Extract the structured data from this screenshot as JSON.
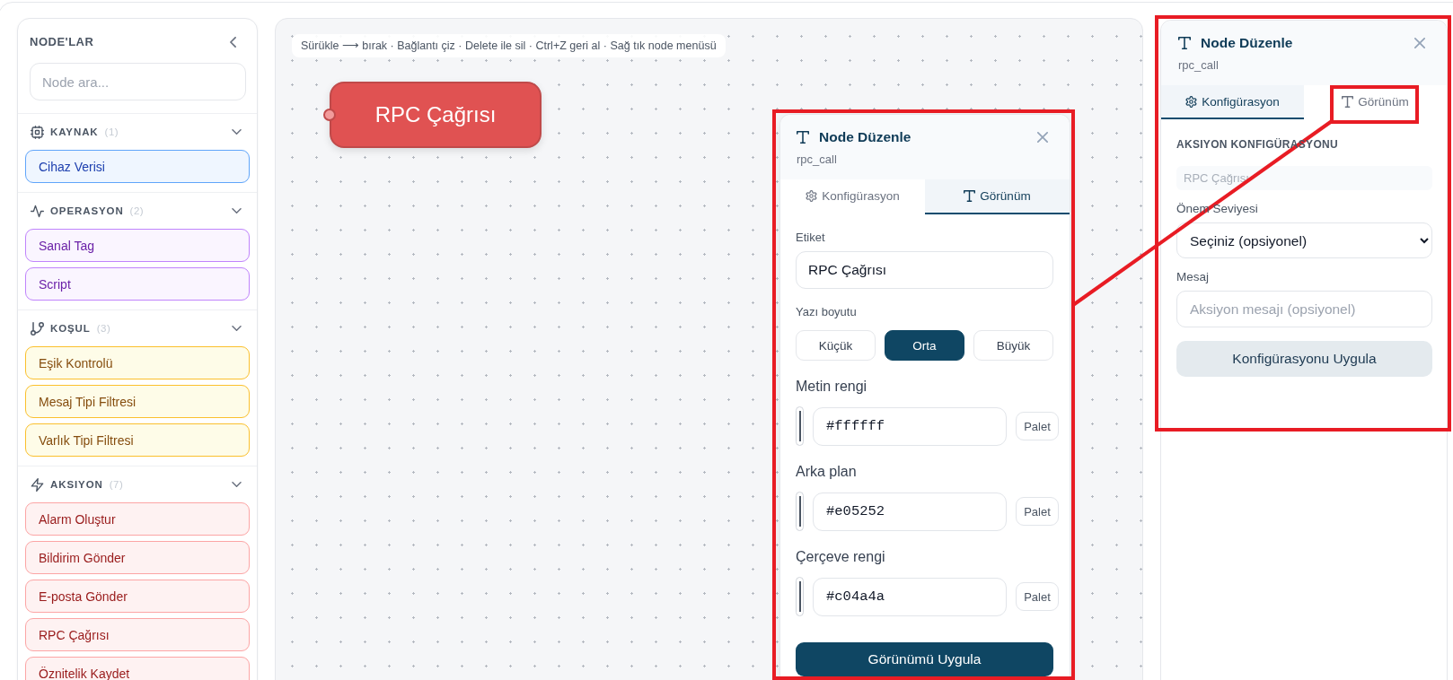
{
  "sidebar": {
    "title": "NODE'LAR",
    "search": {
      "placeholder": "Node ara..."
    },
    "groups": [
      {
        "kind": "source",
        "name": "KAYNAK",
        "count": "(1)",
        "expanded": true,
        "items": [
          {
            "label": "Cihaz Verisi"
          }
        ]
      },
      {
        "kind": "operation",
        "name": "OPERASYON",
        "count": "(2)",
        "expanded": true,
        "items": [
          {
            "label": "Sanal Tag"
          },
          {
            "label": "Script"
          }
        ]
      },
      {
        "kind": "condition",
        "name": "KOŞUL",
        "count": "(3)",
        "expanded": true,
        "items": [
          {
            "label": "Eşik Kontrolü"
          },
          {
            "label": "Mesaj Tipi Filtresi"
          },
          {
            "label": "Varlık Tipi Filtresi"
          }
        ]
      },
      {
        "kind": "action",
        "name": "AKSIYON",
        "count": "(7)",
        "expanded": true,
        "items": [
          {
            "label": "Alarm Oluştur"
          },
          {
            "label": "Bildirim Gönder"
          },
          {
            "label": "E-posta Gönder"
          },
          {
            "label": "RPC Çağrısı"
          },
          {
            "label": "Öznitelik Kaydet"
          }
        ]
      }
    ]
  },
  "canvas": {
    "hint": "Sürükle ⟶ bırak · Bağlantı çiz · Delete ile sil · Ctrl+Z geri al · Sağ tık node menüsü",
    "nodes": [
      {
        "label": "RPC Çağrısı"
      }
    ]
  },
  "appearance_panel": {
    "highlighted": true,
    "title": "Node Düzenle",
    "subtitle": "rpc_call",
    "tabs": [
      {
        "kind": "config",
        "label": "Konfigürasyon",
        "selected": false
      },
      {
        "kind": "appearance",
        "label": "Görünüm",
        "selected": true
      }
    ],
    "label_field": {
      "label": "Etiket",
      "value": "RPC Çağrısı"
    },
    "font_size": {
      "label": "Yazı boyutu",
      "options": [
        {
          "label": "Küçük",
          "selected": false
        },
        {
          "label": "Orta",
          "selected": true
        },
        {
          "label": "Büyük",
          "selected": false
        }
      ]
    },
    "colors": [
      {
        "label": "Metin rengi",
        "value": "#ffffff",
        "button": "Palet"
      },
      {
        "label": "Arka plan",
        "value": "#e05252",
        "button": "Palet"
      },
      {
        "label": "Çerçeve rengi",
        "value": "#c04a4a",
        "button": "Palet"
      }
    ],
    "apply_button": "Görünümü Uygula"
  },
  "edit_panel": {
    "highlighted": true,
    "title": "Node Düzenle",
    "subtitle": "rpc_call",
    "tabs": [
      {
        "kind": "config",
        "label": "Konfigürasyon",
        "selected": true,
        "highlighted": false
      },
      {
        "kind": "appearance",
        "label": "Görünüm",
        "selected": false,
        "highlighted": true
      }
    ],
    "section_title": "AKSIYON KONFIGÜRASYONU",
    "type_field": {
      "value": "RPC Çağrısı",
      "disabled": true
    },
    "fields": [
      {
        "kind": "select",
        "label": "Önem Seviyesi",
        "value": "Seçiniz (opsiyonel)"
      },
      {
        "kind": "text",
        "label": "Mesaj",
        "placeholder": "Aksiyon mesajı (opsiyonel)"
      }
    ],
    "apply_button": "Konfigürasyonu Uygula"
  }
}
